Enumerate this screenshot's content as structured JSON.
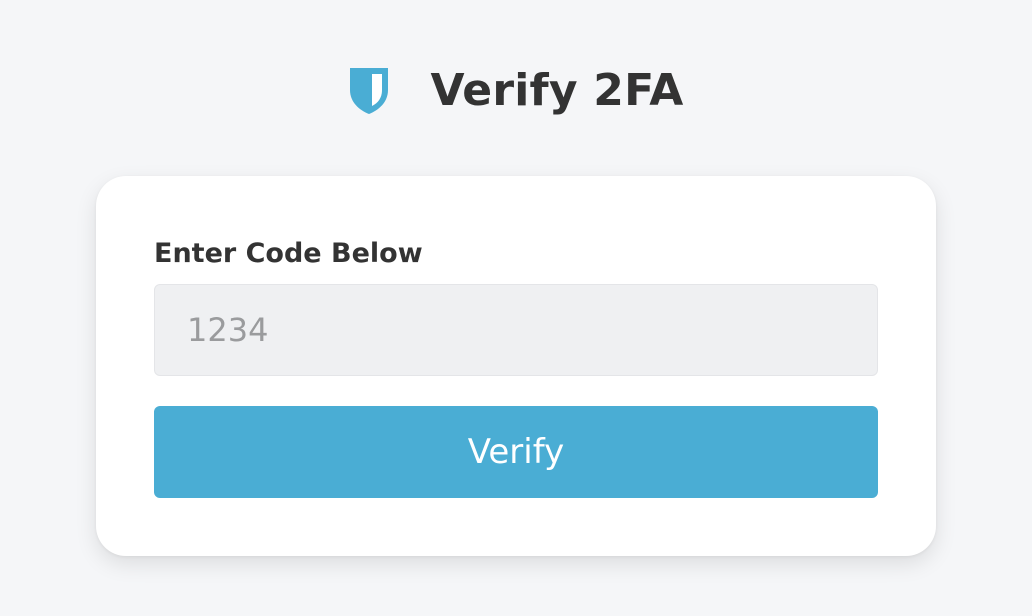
{
  "header": {
    "logo_icon": "shield-icon",
    "title": "Verify 2FA"
  },
  "form": {
    "label": "Enter Code Below",
    "code_input": {
      "value": "",
      "placeholder": "1234"
    },
    "submit_label": "Verify"
  },
  "colors": {
    "accent": "#4aadd4",
    "background": "#f5f6f8",
    "card": "#ffffff",
    "input_bg": "#eff0f2",
    "text": "#333333"
  }
}
